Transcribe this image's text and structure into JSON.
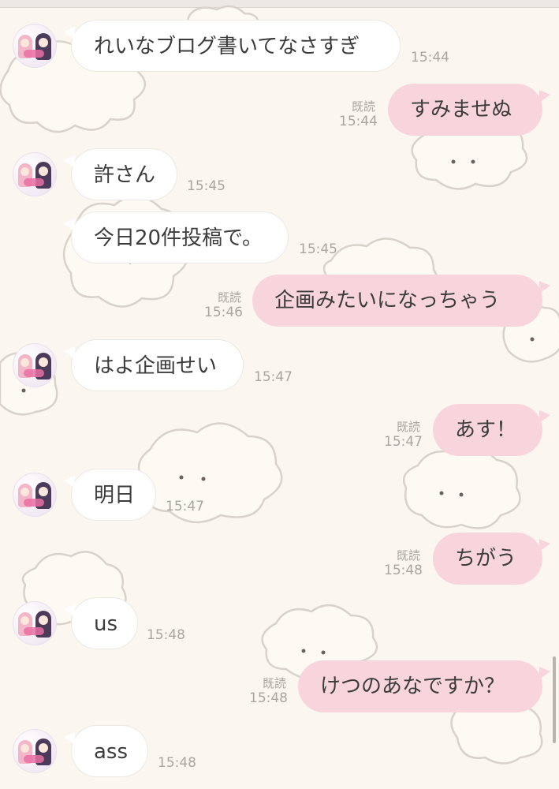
{
  "chat": {
    "messages": [
      {
        "side": "in",
        "text": "れいなブログ書いてなさすぎ",
        "time": "15:44"
      },
      {
        "side": "out",
        "text": "すみませぬ",
        "time": "15:44",
        "read": "既読"
      },
      {
        "side": "in",
        "text": "許さん",
        "time": "15:45"
      },
      {
        "side": "in",
        "text": "今日20件投稿で。",
        "time": "15:45"
      },
      {
        "side": "out",
        "text": "企画みたいになっちゃう",
        "time": "15:46",
        "read": "既読"
      },
      {
        "side": "in",
        "text": "はよ企画せい",
        "time": "15:47"
      },
      {
        "side": "out",
        "text": "あす！",
        "time": "15:47",
        "read": "既読"
      },
      {
        "side": "in",
        "text": "明日",
        "time": "15:47"
      },
      {
        "side": "out",
        "text": "ちがう",
        "time": "15:48",
        "read": "既読"
      },
      {
        "side": "in",
        "text": "us",
        "time": "15:48"
      },
      {
        "side": "out",
        "text": "けつのあなですか？",
        "time": "15:48",
        "read": "既読"
      },
      {
        "side": "in",
        "text": "ass",
        "time": "15:48"
      }
    ]
  },
  "theme": {
    "background": "#fbf6ef",
    "incoming_bubble": "#ffffff",
    "outgoing_bubble": "#f8d5dc",
    "text": "#3c3c3c",
    "meta_text": "#a9a6a2",
    "cloud_outline": "#d8d2ca"
  },
  "icons": {
    "avatar": "avatar-image",
    "background": "cloud-puppy-pattern"
  }
}
